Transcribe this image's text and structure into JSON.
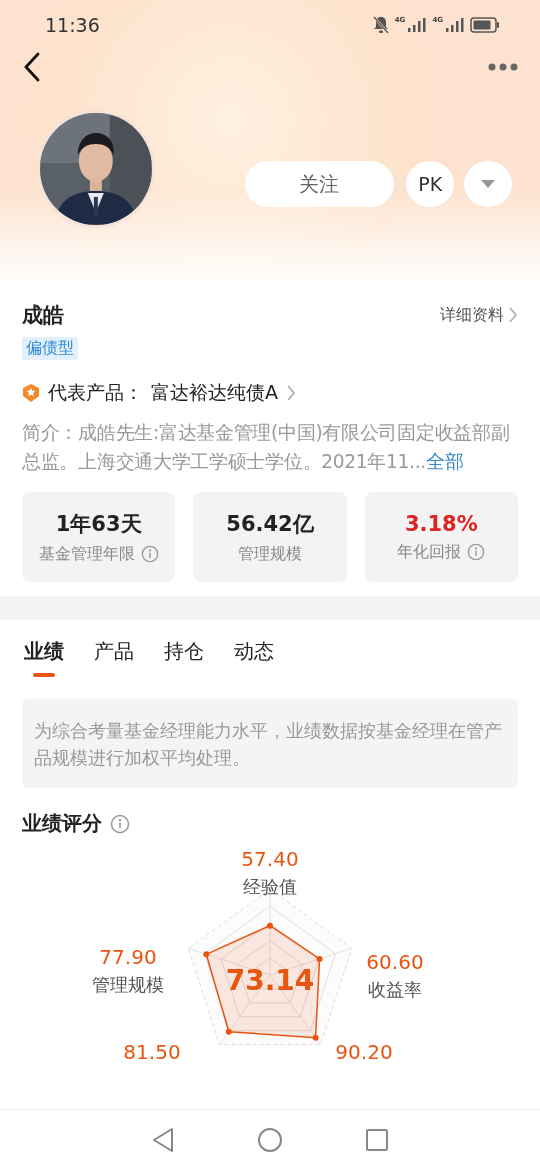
{
  "status_bar": {
    "time": "11:36",
    "signals": [
      "4G",
      "4G"
    ]
  },
  "profile": {
    "follow_button": "关注",
    "pk_button": "PK",
    "name": "成皓",
    "tag": "偏债型",
    "detail_link": "详细资料",
    "product_label": "代表产品：",
    "product_name": "富达裕达纯债A",
    "intro": "简介：成皓先生:富达基金管理(中国)有限公司固定收益部副总监。上海交通大学工学硕士学位。2021年11...",
    "intro_link": "全部"
  },
  "stats": [
    {
      "value": "1年63天",
      "label": "基金管理年限",
      "info": true,
      "color": "#222222"
    },
    {
      "value": "56.42亿",
      "label": "管理规模",
      "info": false,
      "color": "#222222"
    },
    {
      "value": "3.18%",
      "label": "年化回报",
      "info": true,
      "color": "#dd2222"
    }
  ],
  "tabs": [
    {
      "label": "业绩",
      "selected": true
    },
    {
      "label": "产品",
      "selected": false
    },
    {
      "label": "持仓",
      "selected": false
    },
    {
      "label": "动态",
      "selected": false
    }
  ],
  "notice": "为综合考量基金经理能力水平，业绩数据按基金经理在管产品规模进行加权平均处理。",
  "score_section": {
    "title": "业绩评分",
    "total": "73.14",
    "axes": [
      {
        "value": "57.40",
        "label": "经验值"
      },
      {
        "value": "60.60",
        "label": "收益率"
      },
      {
        "value": "90.20"
      },
      {
        "value": "81.50"
      },
      {
        "value": "77.90",
        "label": "管理规模"
      }
    ]
  }
}
